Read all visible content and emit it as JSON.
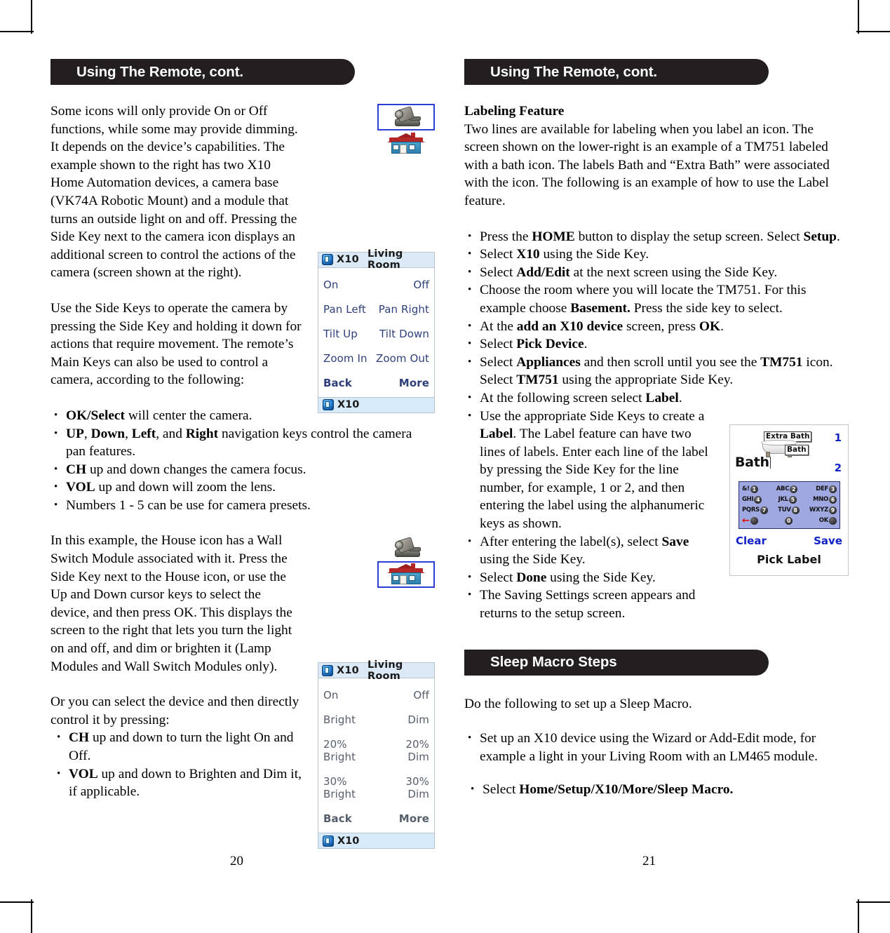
{
  "left_page": {
    "banner": "Using The Remote, cont.",
    "page_number": "20",
    "para1": "Some icons will only provide On or Off functions, while some may provide dimming. It depends on the device’s capabilities. The example shown to the right has two X10 Home Automation devices, a camera base (VK74A Robotic Mount) and a module that turns an outside light on and off. Pressing the Side Key next to the camera icon displays an additional screen to control the actions of the camera (screen shown at the right).",
    "para2": "Use the Side Keys to operate the camera by pressing the Side Key and holding it down for actions that require movement. The remote’s Main Keys can also be used to control a camera, according to the following:",
    "bullets1": [
      {
        "bold": "OK/Select",
        "rest": " will center the camera."
      },
      {
        "bold": "UP",
        "rest": ", <b>Down</b>, <b>Left</b>, and <b>Right</b> navigation keys control the camera pan features."
      },
      {
        "bold": "CH",
        "rest": " up and down changes the camera focus."
      },
      {
        "bold": "VOL",
        "rest": " up and down will zoom the lens."
      },
      {
        "bold": "",
        "rest": "Numbers 1 - 5 can be use for camera presets."
      }
    ],
    "para3": "In this example, the House icon has a Wall Switch Module associated with it. Press the Side Key next to the House icon, or use the Up and Down cursor keys to select the device, and then press OK. This displays the screen to the right that lets you turn the light on and off, and dim or brighten it (Lamp Modules and Wall Switch Modules only).",
    "para4": "Or you can select the device and then directly control it by pressing:",
    "bullets2": [
      {
        "bold": "CH",
        "rest": " up and down to turn the light On and Off."
      },
      {
        "bold": "VOL",
        "rest": " up and down to Brighten and Dim it, if applicable."
      }
    ],
    "icons_top": {
      "camera_icon_selected": true,
      "house_icon_selected": false
    },
    "icons_bottom": {
      "camera_icon_selected": false,
      "house_icon_selected": true
    },
    "camera_screen": {
      "title_badge": "X10",
      "title": "Living Room",
      "rows": [
        {
          "left": "On",
          "right": "Off"
        },
        {
          "left": "Pan Left",
          "right": "Pan Right"
        },
        {
          "left": "Tilt Up",
          "right": "Tilt Down"
        },
        {
          "left": "Zoom In",
          "right": "Zoom Out"
        }
      ],
      "nav": {
        "left": "Back",
        "right": "More"
      },
      "footer": "X10"
    },
    "dim_screen": {
      "title_badge": "X10",
      "title": "Living Room",
      "rows": [
        {
          "left": "On",
          "right": "Off"
        },
        {
          "left": "Bright",
          "right": "Dim"
        },
        {
          "left": "20% Bright",
          "right": "20% Dim"
        },
        {
          "left": "30% Bright",
          "right": "30% Dim"
        }
      ],
      "nav": {
        "left": "Back",
        "right": "More"
      },
      "footer": "X10"
    }
  },
  "right_page": {
    "banner": "Using The Remote, cont.",
    "page_number": "21",
    "heading": "Labeling Feature",
    "para1": "Two lines are available for labeling when you label an icon. The screen shown on the lower-right is an example of a TM751 labeled with a bath icon. The labels Bath and “Extra Bath” were associated with the icon. The following is an example of how to use the Label feature.",
    "bullets": [
      "Press the <b>HOME</b> button to display the setup screen. Select <b>Setup</b>.",
      "Select <b>X10</b> using the Side Key.",
      "Select <b>Add/Edit</b> at the next screen using the Side Key.",
      "Choose the room where you will locate the TM751. For this example choose <b>Basement.</b> Press the side key to select.",
      "At the <b>add an X10 device</b> screen, press <b>OK</b>.",
      "Select <b>Pick Device</b>.",
      "Select <b>Appliances</b> and then scroll until you see the <b>TM751</b> icon. Select <b>TM751</b> using the appropriate Side Key.",
      "At the following screen select <b>Label</b>."
    ],
    "bullets_narrow": [
      "Use the appropriate Side Keys to create a <b>Label</b>. The Label feature can have two lines of labels. Enter each line of the label by pressing the Side Key for the line number, for example, 1 or 2, and then entering the label using the alphanumeric keys as shown.",
      "After entering the label(s), select <b>Save</b> using the Side Key.",
      "Select <b>Done</b> using the Side Key.",
      "The Saving Settings screen appears and returns to the setup screen."
    ],
    "label_screen": {
      "tag_top": "Extra Bath",
      "tag_bottom": "Bath",
      "entry_text": "Bath",
      "line_num_1": "1",
      "line_num_2": "2",
      "keypad": [
        [
          {
            "txt": "&!",
            "key": "1"
          },
          {
            "txt": "ABC",
            "key": "2"
          },
          {
            "txt": "DEF",
            "key": "3"
          }
        ],
        [
          {
            "txt": "GHI",
            "key": "4"
          },
          {
            "txt": "JKL",
            "key": "5"
          },
          {
            "txt": "MNO",
            "key": "6"
          }
        ],
        [
          {
            "txt": "PQRS",
            "key": "7"
          },
          {
            "txt": "TUV",
            "key": "8"
          },
          {
            "txt": "WXYZ",
            "key": "9"
          }
        ],
        [
          {
            "txt": "",
            "key": ""
          },
          {
            "txt": "",
            "key": "0"
          },
          {
            "txt": "OK",
            "key": ""
          }
        ]
      ],
      "nav_left": "Clear",
      "nav_right": "Save",
      "footer": "Pick Label"
    },
    "sleep_banner": "Sleep Macro Steps",
    "sleep_intro": "Do the following to set up a Sleep Macro.",
    "sleep_bullets": [
      "Set up an X10 device using the Wizard or Add-Edit mode, for example a light in your Living Room with an LM465 module.",
      "Select <b>Home/Setup/X10/More/Sleep Macro.</b>"
    ]
  }
}
